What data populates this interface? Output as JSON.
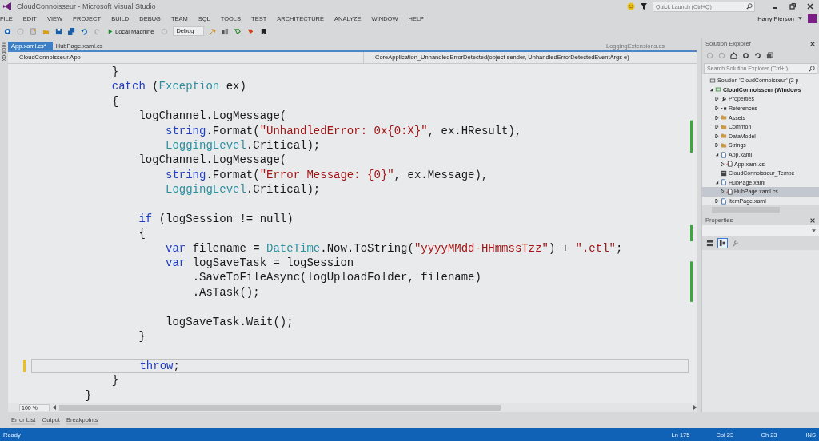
{
  "window": {
    "title": "CloudConnoisseur - Microsoft Visual Studio",
    "quick_launch": {
      "placeholder": "Quick Launch (Ctrl+Q)"
    },
    "user": "Harry Pierson"
  },
  "menu": [
    "FILE",
    "EDIT",
    "VIEW",
    "PROJECT",
    "BUILD",
    "DEBUG",
    "TEAM",
    "SQL",
    "TOOLS",
    "TEST",
    "ARCHITECTURE",
    "ANALYZE",
    "WINDOW",
    "HELP"
  ],
  "toolbar": {
    "target": "Local Machine",
    "configuration": "Debug"
  },
  "toolbox_label": "Toolbox",
  "tabs": [
    {
      "label": "App.xaml.cs*",
      "selected": true
    },
    {
      "label": "HubPage.xaml.cs",
      "selected": false
    }
  ],
  "preview_tab": "LoggingExtensions.cs",
  "nav_bar": {
    "type": "CloudConnoisseur.App",
    "member": "CoreApplication_UnhandledErrorDetected(object sender, UnhandledErrorDetectedEventArgs e)"
  },
  "code": [
    {
      "kind": "block",
      "children": [
        {
          "kind": "line",
          "current": false,
          "changed": false,
          "tokens": [
            {
              "kind": "plain",
              "text": "}"
            }
          ]
        },
        {
          "kind": "line",
          "current": false,
          "changed": false,
          "tokens": [
            {
              "kind": "keyword",
              "text": "catch"
            },
            {
              "kind": "plain",
              "text": " ("
            },
            {
              "kind": "type",
              "text": "Exception"
            },
            {
              "kind": "plain",
              "text": " ex)"
            }
          ]
        },
        {
          "kind": "line",
          "current": false,
          "changed": false,
          "tokens": [
            {
              "kind": "plain",
              "text": "{"
            }
          ]
        },
        {
          "kind": "block",
          "children": [
            {
              "kind": "line",
              "current": false,
              "changed": false,
              "tokens": [
                {
                  "kind": "plain",
                  "text": "logChannel.LogMessage("
                }
              ],
              "children": [
                {
                  "kind": "line",
                  "current": false,
                  "changed": false,
                  "tokens": [
                    {
                      "kind": "keyword",
                      "text": "string"
                    },
                    {
                      "kind": "plain",
                      "text": ".Format("
                    },
                    {
                      "kind": "string",
                      "text": "\"UnhandledError: 0x{0:X}\""
                    },
                    {
                      "kind": "plain",
                      "text": ", ex.HResult),"
                    }
                  ]
                },
                {
                  "kind": "line",
                  "current": false,
                  "changed": false,
                  "tokens": [
                    {
                      "kind": "type",
                      "text": "LoggingLevel"
                    },
                    {
                      "kind": "plain",
                      "text": ".Critical);"
                    }
                  ]
                }
              ]
            },
            {
              "kind": "line",
              "current": false,
              "changed": false,
              "tokens": [
                {
                  "kind": "plain",
                  "text": "logChannel.LogMessage("
                }
              ],
              "children": [
                {
                  "kind": "line",
                  "current": false,
                  "changed": false,
                  "tokens": [
                    {
                      "kind": "keyword",
                      "text": "string"
                    },
                    {
                      "kind": "plain",
                      "text": ".Format("
                    },
                    {
                      "kind": "string",
                      "text": "\"Error Message: {0}\""
                    },
                    {
                      "kind": "plain",
                      "text": ", ex.Message),"
                    }
                  ]
                },
                {
                  "kind": "line",
                  "current": false,
                  "changed": false,
                  "tokens": [
                    {
                      "kind": "type",
                      "text": "LoggingLevel"
                    },
                    {
                      "kind": "plain",
                      "text": ".Critical);"
                    }
                  ]
                }
              ]
            },
            {
              "kind": "line",
              "current": false,
              "changed": false
            },
            {
              "kind": "line",
              "current": false,
              "changed": false,
              "tokens": [
                {
                  "kind": "keyword",
                  "text": "if"
                },
                {
                  "kind": "plain",
                  "text": " (logSession != null)"
                }
              ]
            },
            {
              "kind": "line",
              "current": false,
              "changed": false,
              "tokens": [
                {
                  "kind": "plain",
                  "text": "{"
                }
              ]
            },
            {
              "kind": "block",
              "children": [
                {
                  "kind": "line",
                  "current": false,
                  "changed": false,
                  "tokens": [
                    {
                      "kind": "keyword",
                      "text": "var"
                    },
                    {
                      "kind": "plain",
                      "text": " filename = "
                    },
                    {
                      "kind": "type",
                      "text": "DateTime"
                    },
                    {
                      "kind": "plain",
                      "text": ".Now.ToString("
                    },
                    {
                      "kind": "string",
                      "text": "\"yyyyMMdd-HHmmssTzz\""
                    },
                    {
                      "kind": "plain",
                      "text": ") + "
                    },
                    {
                      "kind": "string",
                      "text": "\".etl\""
                    },
                    {
                      "kind": "plain",
                      "text": ";"
                    }
                  ]
                },
                {
                  "kind": "line",
                  "current": false,
                  "changed": false,
                  "tokens": [
                    {
                      "kind": "keyword",
                      "text": "var"
                    },
                    {
                      "kind": "plain",
                      "text": " logSaveTask = logSession"
                    }
                  ],
                  "children": [
                    {
                      "kind": "line",
                      "current": false,
                      "changed": false,
                      "tokens": [
                        {
                          "kind": "plain",
                          "text": ".SaveToFileAsync(logUploadFolder, filename)"
                        }
                      ]
                    },
                    {
                      "kind": "line",
                      "current": false,
                      "changed": false,
                      "tokens": [
                        {
                          "kind": "plain",
                          "text": ".AsTask();"
                        }
                      ]
                    }
                  ]
                },
                {
                  "kind": "line",
                  "current": false,
                  "changed": false
                },
                {
                  "kind": "line",
                  "current": false,
                  "changed": false,
                  "tokens": [
                    {
                      "kind": "plain",
                      "text": "logSaveTask.Wait();"
                    }
                  ]
                }
              ]
            },
            {
              "kind": "line",
              "current": false,
              "changed": false,
              "tokens": [
                {
                  "kind": "plain",
                  "text": "}"
                }
              ]
            },
            {
              "kind": "line",
              "current": false,
              "changed": false
            },
            {
              "kind": "line",
              "current": true,
              "changed": true,
              "tokens": [
                {
                  "kind": "keyword",
                  "text": "throw"
                },
                {
                  "kind": "plain",
                  "text": ";"
                }
              ]
            }
          ]
        },
        {
          "kind": "line",
          "current": false,
          "changed": false,
          "tokens": [
            {
              "kind": "plain",
              "text": "}"
            }
          ]
        }
      ]
    },
    {
      "kind": "line",
      "current": false,
      "changed": false,
      "tokens": [
        {
          "kind": "plain",
          "text": "}"
        }
      ]
    }
  ],
  "zoom": "100 %",
  "solution_explorer": {
    "title": "Solution Explorer",
    "search": {
      "placeholder": "Search Solution Explorer (Ctrl+;)"
    },
    "tree": [
      {
        "label": "Solution 'CloudConnoisseur' (2 p",
        "kind": "solution",
        "selected": false,
        "children": [
          {
            "label": "CloudConnoisseur (Windows",
            "kind": "project",
            "expanded": true,
            "selected": false,
            "children": [
              {
                "label": "Properties",
                "kind": "properties",
                "expanded": false,
                "selected": false
              },
              {
                "label": "References",
                "kind": "references",
                "expanded": false,
                "selected": false
              },
              {
                "label": "Assets",
                "kind": "folder",
                "expanded": false,
                "selected": false
              },
              {
                "label": "Common",
                "kind": "folder",
                "expanded": false,
                "selected": false
              },
              {
                "label": "DataModel",
                "kind": "folder",
                "expanded": false,
                "selected": false
              },
              {
                "label": "Strings",
                "kind": "folder",
                "expanded": false,
                "selected": false
              },
              {
                "label": "App.xaml",
                "kind": "xaml",
                "expanded": true,
                "selected": false,
                "children": [
                  {
                    "label": "App.xaml.cs",
                    "kind": "cs",
                    "expanded": false,
                    "selected": false
                  }
                ]
              },
              {
                "label": "CloudConnoisseur_Tempc",
                "kind": "template",
                "selected": false
              },
              {
                "label": "HubPage.xaml",
                "kind": "xaml",
                "expanded": true,
                "selected": false,
                "children": [
                  {
                    "label": "HubPage.xaml.cs",
                    "kind": "cs",
                    "expanded": false,
                    "selected": true
                  }
                ]
              },
              {
                "label": "ItemPage.xaml",
                "kind": "xaml",
                "expanded": false,
                "selected": false
              }
            ]
          }
        ]
      }
    ]
  },
  "properties": {
    "title": "Properties"
  },
  "bottom_tabs": [
    "Error List",
    "Output",
    "Breakpoints"
  ],
  "status_bar": {
    "message": "Ready",
    "line": "Ln 175",
    "column": "Col 23",
    "char": "Ch 23",
    "mode": "INS"
  }
}
